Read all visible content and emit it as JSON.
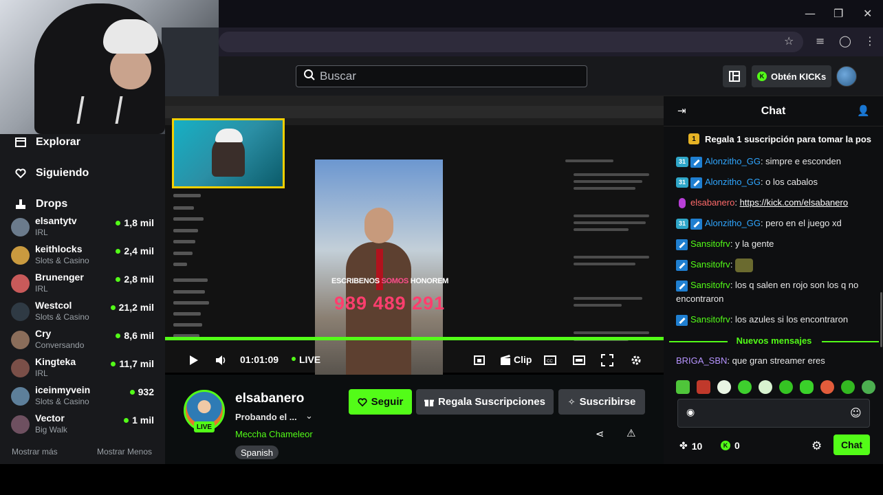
{
  "header": {
    "search_placeholder": "Buscar",
    "kicks_button": "Obtén KICKs"
  },
  "sidebar": {
    "nav": [
      {
        "label": "Explorar",
        "icon": "browse-icon"
      },
      {
        "label": "Siguiendo",
        "icon": "heart-icon"
      },
      {
        "label": "Drops",
        "icon": "drops-icon"
      }
    ],
    "channels": [
      {
        "name": "elsantytv",
        "category": "IRL",
        "viewers": "1,8 mil",
        "color": "#6b7b8c"
      },
      {
        "name": "keithlocks",
        "category": "Slots & Casino",
        "viewers": "2,4 mil",
        "color": "#c99a3f"
      },
      {
        "name": "Brunenger",
        "category": "IRL",
        "viewers": "2,8 mil",
        "color": "#c85a5a"
      },
      {
        "name": "Westcol",
        "category": "Slots & Casino",
        "viewers": "21,2 mil",
        "color": "#2f3a44"
      },
      {
        "name": "Cry",
        "category": "Conversando",
        "viewers": "8,6 mil",
        "color": "#8a6d5a"
      },
      {
        "name": "Kingteka",
        "category": "IRL",
        "viewers": "11,7 mil",
        "color": "#7a4f48"
      },
      {
        "name": "iceinmyvein",
        "category": "Slots & Casino",
        "viewers": "932",
        "color": "#5d7f9a"
      },
      {
        "name": "Vector",
        "category": "Big Walk",
        "viewers": "1 mil",
        "color": "#6e5060"
      }
    ],
    "show_more": "Mostrar más",
    "show_less": "Mostrar Menos"
  },
  "player": {
    "time": "01:01:09",
    "live_label": "LIVE",
    "clip_label": "Clip",
    "caption_a": "ESCRIBENOS",
    "caption_b": "SOMOS",
    "caption_c": "HONOREM",
    "phone": "989 489 291"
  },
  "stream": {
    "streamer": "elsabanero",
    "live_badge": "LIVE",
    "title": "Probando el ...",
    "category": "Meccha Chameleor",
    "language": "Spanish",
    "follow_label": "Seguir",
    "gift_label": "Regala Suscripciones",
    "subscribe_label": "Suscribirse"
  },
  "chat": {
    "title": "Chat",
    "pinned": "Regala 1 suscripción para tomar la pos",
    "messages": [
      {
        "user": "Alonzitho_GG",
        "text": ": simpre e esconden",
        "badge": "31"
      },
      {
        "user": "Alonzitho_GG",
        "text": ": o los cabalos",
        "badge": "31"
      },
      {
        "user": "elsabanero",
        "text": ": ",
        "link": "https://kick.com/elsabanero"
      },
      {
        "user": "Alonzitho_GG",
        "text": ": pero en el juego xd",
        "badge": "31"
      },
      {
        "user": "Sansitofrv",
        "text": ": y la gente"
      },
      {
        "user": "Sansitofrv",
        "text": ": "
      },
      {
        "user": "Sansitofrv",
        "text": ": los q salen en rojo son los q no encontraron"
      },
      {
        "user": "Sansitofrv",
        "text": ": los azules si los encontraron"
      },
      {
        "user": "BRIGA_SBN",
        "text": ": que gran streamer eres"
      }
    ],
    "new_messages_label": "Nuevos mensajes",
    "kicks_count": "10",
    "points_count": "0",
    "send_label": "Chat",
    "colors": {
      "accent": "#53fc18",
      "blue_user": "#2fa6ff",
      "red_user": "#ff6a6a",
      "purple_user": "#b694ff"
    }
  }
}
